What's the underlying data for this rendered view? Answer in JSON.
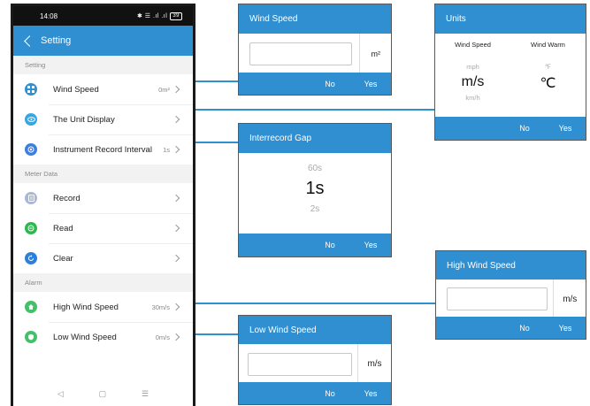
{
  "phone": {
    "status": {
      "time": "14:08",
      "icons": "✱ ☰ .ıl .ıl",
      "battery": "39"
    },
    "header": {
      "title": "Setting"
    },
    "sections": [
      {
        "label": "Setting",
        "rows": [
          {
            "label": "Wind Speed",
            "value": "0m²",
            "icon_color": "#2f8fd1",
            "icon": "grid-icon"
          },
          {
            "label": "The Unit Display",
            "value": "",
            "icon_color": "#38a6e0",
            "icon": "eye-icon"
          },
          {
            "label": "Instrument Record Interval",
            "value": "1s",
            "icon_color": "#3d7fe0",
            "icon": "record-icon"
          }
        ]
      },
      {
        "label": "Meter Data",
        "rows": [
          {
            "label": "Record",
            "value": "",
            "icon_color": "#a9b7d6",
            "icon": "document-icon"
          },
          {
            "label": "Read",
            "value": "",
            "icon_color": "#2db84e",
            "icon": "chat-icon"
          },
          {
            "label": "Clear",
            "value": "",
            "icon_color": "#2e7fd8",
            "icon": "refresh-icon"
          }
        ]
      },
      {
        "label": "Alarm",
        "rows": [
          {
            "label": "High Wind Speed",
            "value": "30m/s",
            "icon_color": "#43c06a",
            "icon": "home-icon"
          },
          {
            "label": "Low Wind Speed",
            "value": "0m/s",
            "icon_color": "#43c06a",
            "icon": "shield-icon"
          }
        ]
      }
    ],
    "nav": {
      "back": "◁",
      "home": "▢",
      "menu": "☰"
    }
  },
  "dialogs": {
    "wind_speed": {
      "title": "Wind Speed",
      "unit": "m²",
      "placeholder": "",
      "no": "No",
      "yes": "Yes"
    },
    "units": {
      "title": "Units",
      "col1": {
        "header": "Wind Speed",
        "above": "mph",
        "selected": "m/s",
        "below": "km/h"
      },
      "col2": {
        "header": "Wind Warm",
        "above": "℉",
        "selected": "℃",
        "below": ""
      },
      "no": "No",
      "yes": "Yes"
    },
    "interrecord": {
      "title": "Interrecord Gap",
      "above": "60s",
      "selected": "1s",
      "below": "2s",
      "no": "No",
      "yes": "Yes"
    },
    "high_wind": {
      "title": "High Wind Speed",
      "unit": "m/s",
      "no": "No",
      "yes": "Yes"
    },
    "low_wind": {
      "title": "Low Wind Speed",
      "unit": "m/s",
      "no": "No",
      "yes": "Yes"
    }
  },
  "colors": {
    "accent": "#2f8fd1",
    "section_bg": "#f2f2f2"
  }
}
